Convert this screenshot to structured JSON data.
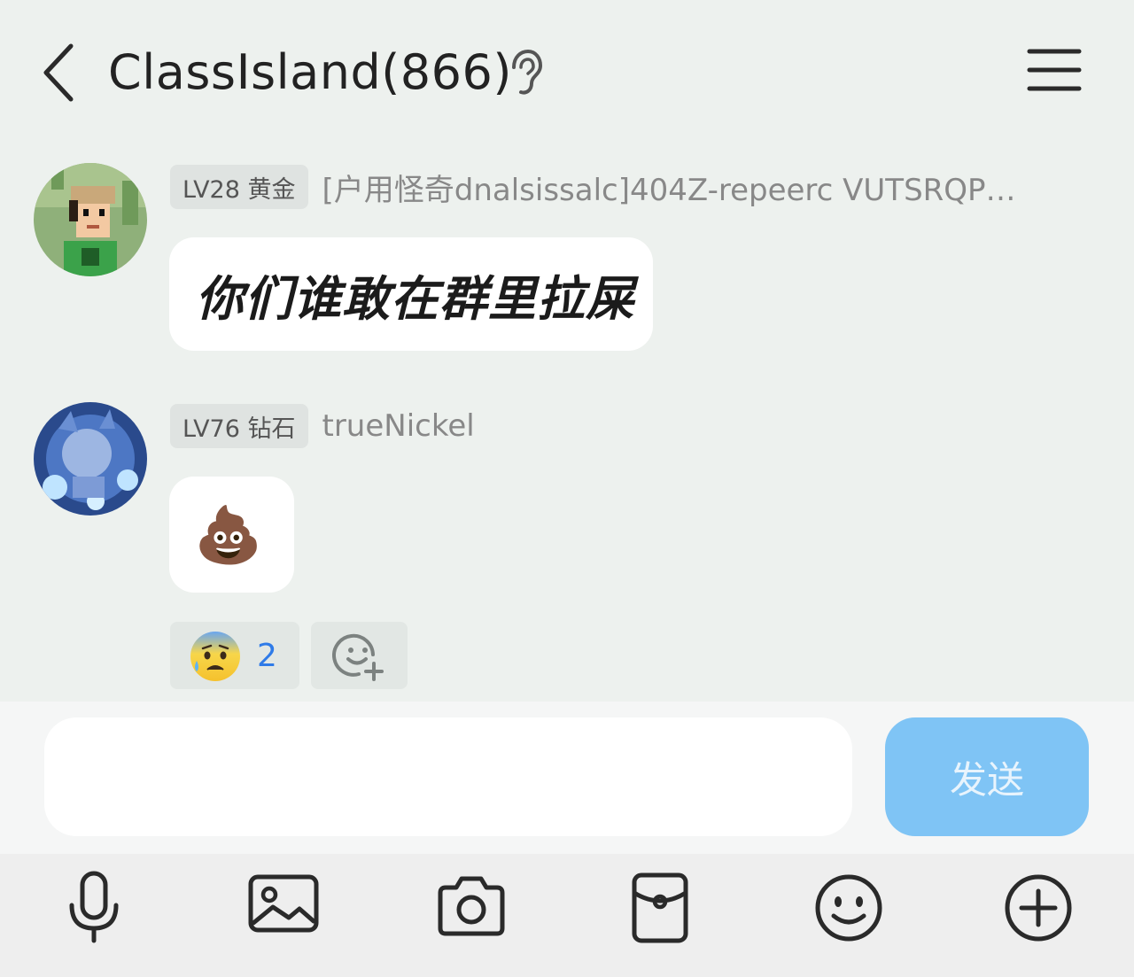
{
  "header": {
    "title": "ClassIsland(866)"
  },
  "messages": [
    {
      "level_badge": "LV28 黄金",
      "nickname": "[户用怪奇dnalsissalc]404Z-repeerc VUTSRQP…",
      "text": "你们谁敢在群里拉屎"
    },
    {
      "level_badge": "LV76 钻石",
      "nickname": "trueNickel",
      "text": "💩"
    }
  ],
  "reactions": [
    {
      "emoji": "😰",
      "count": "2"
    }
  ],
  "input": {
    "value": "",
    "send_label": "发送"
  },
  "colors": {
    "send_button": "#7fc4f5",
    "reaction_count": "#2f7be8",
    "background": "#edf1ee"
  },
  "icons": [
    "back-icon",
    "ear-icon",
    "menu-icon",
    "add-reaction-icon",
    "microphone-icon",
    "image-icon",
    "camera-icon",
    "red-packet-icon",
    "emoji-icon",
    "plus-icon"
  ]
}
